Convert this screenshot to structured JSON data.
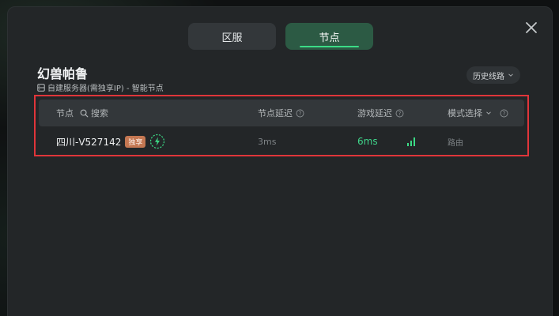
{
  "tabs": [
    {
      "label": "区服",
      "active": false
    },
    {
      "label": "节点",
      "active": true
    }
  ],
  "game": {
    "title": "幻兽帕鲁",
    "subtitle": "自建服务器(需独享IP) - 智能节点"
  },
  "history_button": {
    "label": "历史线路"
  },
  "table": {
    "headers": {
      "node": "节点",
      "search": "搜索",
      "node_latency": "节点延迟",
      "game_latency": "游戏延迟",
      "mode": "模式选择"
    },
    "rows": [
      {
        "node": "四川-V527142",
        "badge": "独享",
        "node_latency": "3ms",
        "game_latency": "6ms",
        "mode": "路由"
      }
    ]
  },
  "colors": {
    "accent": "#3bdc86",
    "highlight_border": "#e0353a",
    "badge": "#c47752"
  },
  "icons": [
    "close-icon",
    "server-icon",
    "chevron-down-icon",
    "search-icon",
    "help-icon",
    "lightning-icon",
    "signal-icon"
  ]
}
